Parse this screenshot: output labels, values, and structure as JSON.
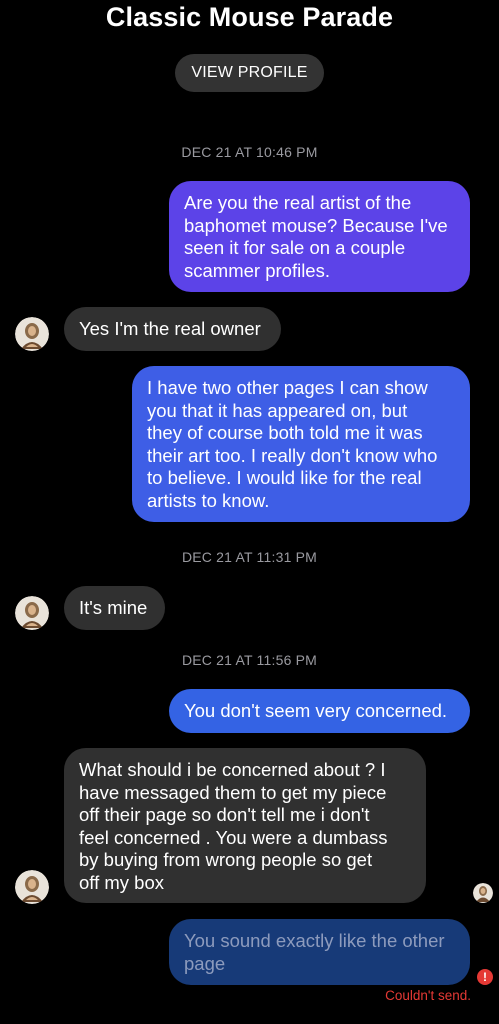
{
  "header": {
    "title": "Classic Mouse Parade",
    "view_profile_label": "VIEW PROFILE"
  },
  "timestamps": [
    "DEC 21 AT 10:46 PM",
    "DEC 21 AT 11:31 PM",
    "DEC 21 AT 11:56 PM"
  ],
  "messages": [
    {
      "from": "me",
      "text": "Are you the real artist of the\nbaphomet mouse? Because I've\nseen it for sale on a couple\nscammer profiles."
    },
    {
      "from": "them",
      "text": "Yes I'm the real owner"
    },
    {
      "from": "me",
      "text": "I have two other pages I can show\nyou that it has appeared on, but\nthey of course both told me it was\ntheir art too. I really don't know who\nto believe. I would like for the real\nartists to know."
    },
    {
      "from": "them",
      "text": "It's mine"
    },
    {
      "from": "me",
      "text": "You don't seem very concerned."
    },
    {
      "from": "them",
      "text": "What should i be concerned about ? I\nhave messaged them to get my piece\noff their page so don't tell me i don't\nfeel concerned . You were a dumbass\nby buying from wrong people so get\noff my box"
    },
    {
      "from": "me",
      "text": "You sound exactly like the other\npage",
      "status": "failed"
    }
  ],
  "status": {
    "failed_label": "Couldn't send.",
    "failed_icon": "!"
  },
  "colors": {
    "bubble_in": "#303030",
    "bubble_out_top": "#6240e8",
    "bubble_out_bottom": "#3a63e2",
    "failed_bubble": "#173a78",
    "error": "#e53935"
  }
}
